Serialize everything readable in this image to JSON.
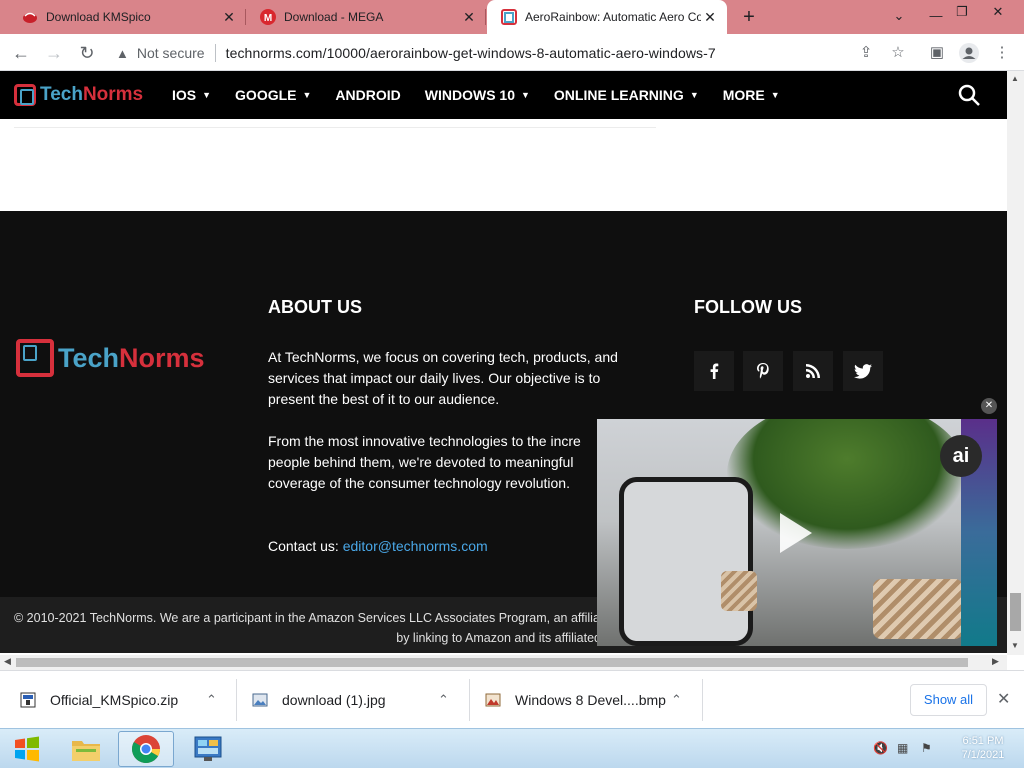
{
  "browser": {
    "tabs": [
      {
        "title": "Download KMSpico",
        "active": false
      },
      {
        "title": "Download - MEGA",
        "active": false
      },
      {
        "title": "AeroRainbow: Automatic Aero Co",
        "active": true
      }
    ],
    "new_tab_label": "+",
    "security_label": "Not secure",
    "url": "technorms.com/10000/aerorainbow-get-windows-8-automatic-aero-windows-7"
  },
  "site": {
    "logo_part1": "Tech",
    "logo_part2": "Norms",
    "nav": [
      {
        "label": "IOS",
        "has_menu": true
      },
      {
        "label": "GOOGLE",
        "has_menu": true
      },
      {
        "label": "ANDROID",
        "has_menu": false
      },
      {
        "label": "WINDOWS 10",
        "has_menu": true
      },
      {
        "label": "ONLINE LEARNING",
        "has_menu": true
      },
      {
        "label": "MORE",
        "has_menu": true
      }
    ]
  },
  "footer": {
    "about_heading": "ABOUT US",
    "about_p1": "At TechNorms, we focus on covering tech, products, and services that impact our daily lives. Our objective is to present the best of it to our audience.",
    "about_p2_l1": "From the most innovative technologies to the incre",
    "about_p2_l2": "people behind them, we're devoted to meaningful",
    "about_p2_l3": "coverage of the consumer technology revolution.",
    "contact_label": "Contact us:",
    "contact_email": "editor@technorms.com",
    "follow_heading": "FOLLOW US",
    "social": [
      "f",
      "P",
      "rss",
      "twitter"
    ],
    "copyright_l1": "© 2010-2021 TechNorms. We are a participant in the Amazon Services LLC Associates Program, an affiliat",
    "copyright_l2": "by linking to Amazon and its affiliated s"
  },
  "video": {
    "badge": "ai"
  },
  "downloads": [
    {
      "name": "Official_KMSpico.zip",
      "type": "zip"
    },
    {
      "name": "download (1).jpg",
      "type": "image"
    },
    {
      "name": "Windows 8 Devel....bmp",
      "type": "image"
    }
  ],
  "download_shelf": {
    "show_all": "Show all"
  },
  "taskbar": {
    "clock_time": "6:51 PM",
    "clock_date": "7/1/2021"
  },
  "colors": {
    "tabstrip": "#d9848a",
    "logo_blue": "#4aa3c8",
    "logo_red": "#d6303c",
    "footer_bg": "#0f0f0f",
    "link": "#4aa8e8"
  }
}
